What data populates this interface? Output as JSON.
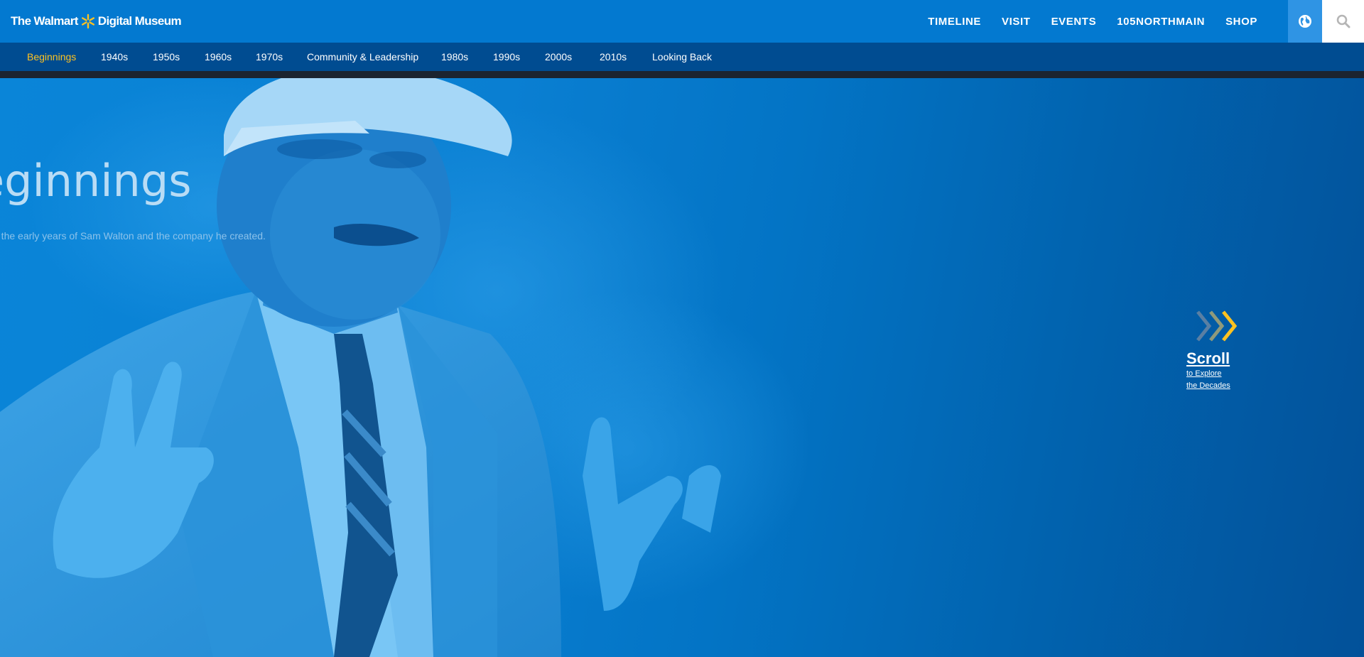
{
  "brand": {
    "logo_prefix": "The Walmart",
    "logo_suffix": "Digital Museum",
    "spark_color": "#ffc220"
  },
  "main_nav": [
    {
      "label": "TIMELINE"
    },
    {
      "label": "VISIT"
    },
    {
      "label": "EVENTS"
    },
    {
      "label": "105NORTHMAIN"
    },
    {
      "label": "SHOP"
    }
  ],
  "icons": {
    "globe": "globe-icon",
    "search": "search-icon",
    "scroll": "triple-chevron-right-icon"
  },
  "sub_nav": [
    {
      "label": "Beginnings",
      "active": true
    },
    {
      "label": "1940s"
    },
    {
      "label": "1950s"
    },
    {
      "label": "1960s"
    },
    {
      "label": "1970s"
    },
    {
      "label": "Community & Leadership"
    },
    {
      "label": "1980s"
    },
    {
      "label": "1990s"
    },
    {
      "label": "2000s"
    },
    {
      "label": "2010s"
    },
    {
      "label": "Looking Back"
    }
  ],
  "hero": {
    "title": "eginnings",
    "subtitle": "e the early years of Sam Walton and the company he created."
  },
  "scroll_cue": {
    "label": "Scroll",
    "line1": "to Explore",
    "line2": "the Decades"
  },
  "colors": {
    "header_blue": "#0379d0",
    "subnav_blue": "#004c91",
    "active_yellow": "#ffc220",
    "globe_button": "#2f94e4"
  }
}
